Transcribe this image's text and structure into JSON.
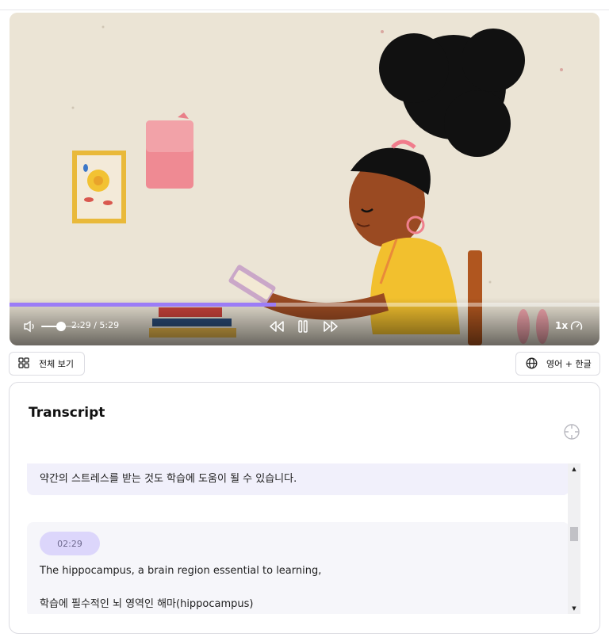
{
  "video": {
    "current_time": "2:29",
    "duration": "5:29",
    "time_display": "2:29 / 5:29",
    "progress_fraction": 0.452,
    "volume_fraction": 0.5,
    "speed_label": "1x",
    "accent_color": "#9b7cf6"
  },
  "toolbar": {
    "full_view_label": "전체 보기",
    "language_label": "영어 + 한글"
  },
  "transcript": {
    "title": "Transcript",
    "segments": [
      {
        "ko": "약간의 스트레스를 받는 것도 학습에 도움이 될 수 있습니다."
      },
      {
        "timestamp": "02:29",
        "en": "The hippocampus, a brain region essential to learning,",
        "ko": "학습에 필수적인 뇌 영역인 해마(hippocampus)"
      }
    ]
  },
  "icons": {
    "volume": "volume-icon",
    "rewind": "rewind-icon",
    "pause": "pause-icon",
    "forward": "fast-forward-icon",
    "speed": "speedometer-icon",
    "grid": "grid-icon",
    "globe": "globe-icon",
    "sync": "crosshair-icon"
  }
}
